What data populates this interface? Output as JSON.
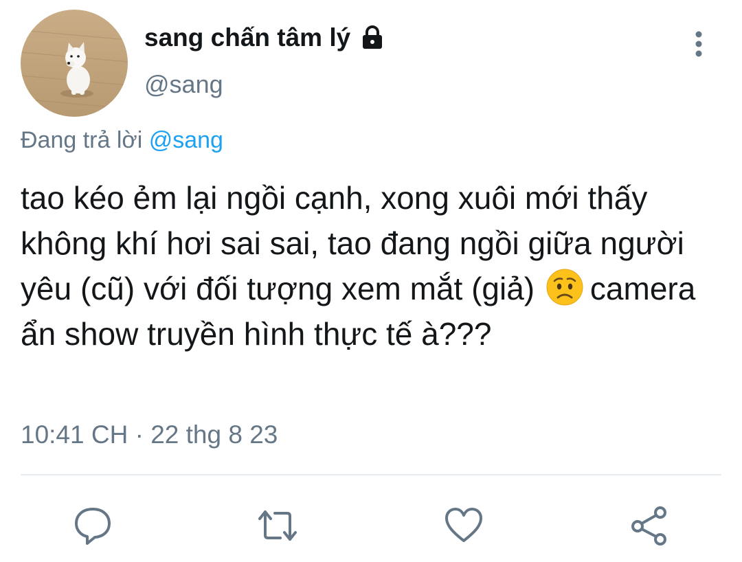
{
  "tweet": {
    "author": {
      "display_name": "sang chấn tâm lý",
      "handle": "@sang",
      "avatar": "dog-avatar",
      "protected_icon": "lock-icon"
    },
    "menu_icon": "more-vertical-icon",
    "reply_prefix": "Đang trả lời",
    "reply_mention": "@sang",
    "text_before_emoji": "tao kéo ẻm lại ngồi cạnh, xong xuôi mới thấy không khí hơi sai sai, tao đang ngồi giữa người yêu (cũ) với đối tượng xem mắt (giả)",
    "emoji": "worried-face-emoji",
    "text_after_emoji": "camera ẩn show truyền hình thực tế à???",
    "timestamp": "10:41 CH · 22 thg 8 23"
  },
  "actions": [
    {
      "name": "reply",
      "icon": "speech-bubble-icon"
    },
    {
      "name": "retweet",
      "icon": "retweet-icon"
    },
    {
      "name": "like",
      "icon": "heart-icon"
    },
    {
      "name": "share",
      "icon": "share-icon"
    }
  ],
  "colors": {
    "text": "#14171a",
    "secondary": "#657786",
    "link": "#1da1f2",
    "divider": "#e6ecf0"
  }
}
